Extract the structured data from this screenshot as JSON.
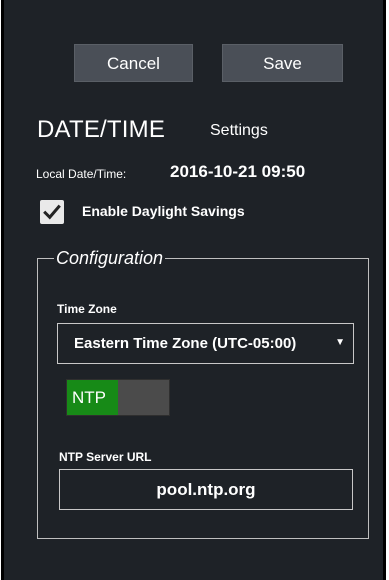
{
  "buttons": {
    "cancel": "Cancel",
    "save": "Save"
  },
  "header": {
    "title": "DATE/TIME",
    "subtitle": "Settings"
  },
  "local_datetime": {
    "label": "Local Date/Time:",
    "value": "2016-10-21 09:50"
  },
  "daylight": {
    "label": "Enable Daylight Savings",
    "checked": true
  },
  "configuration": {
    "legend": "Configuration",
    "timezone": {
      "label": "Time Zone",
      "selected": "Eastern Time Zone (UTC-05:00)"
    },
    "ntp_toggle": {
      "label": "NTP",
      "on": true
    },
    "ntp_server": {
      "label": "NTP Server URL",
      "value": "pool.ntp.org"
    }
  },
  "colors": {
    "panel_bg": "#1e2227",
    "button_bg": "#4a4f57",
    "toggle_on": "#178a17"
  },
  "icons": {
    "checkbox": "checkmark-icon",
    "dropdown": "caret-down-icon"
  }
}
